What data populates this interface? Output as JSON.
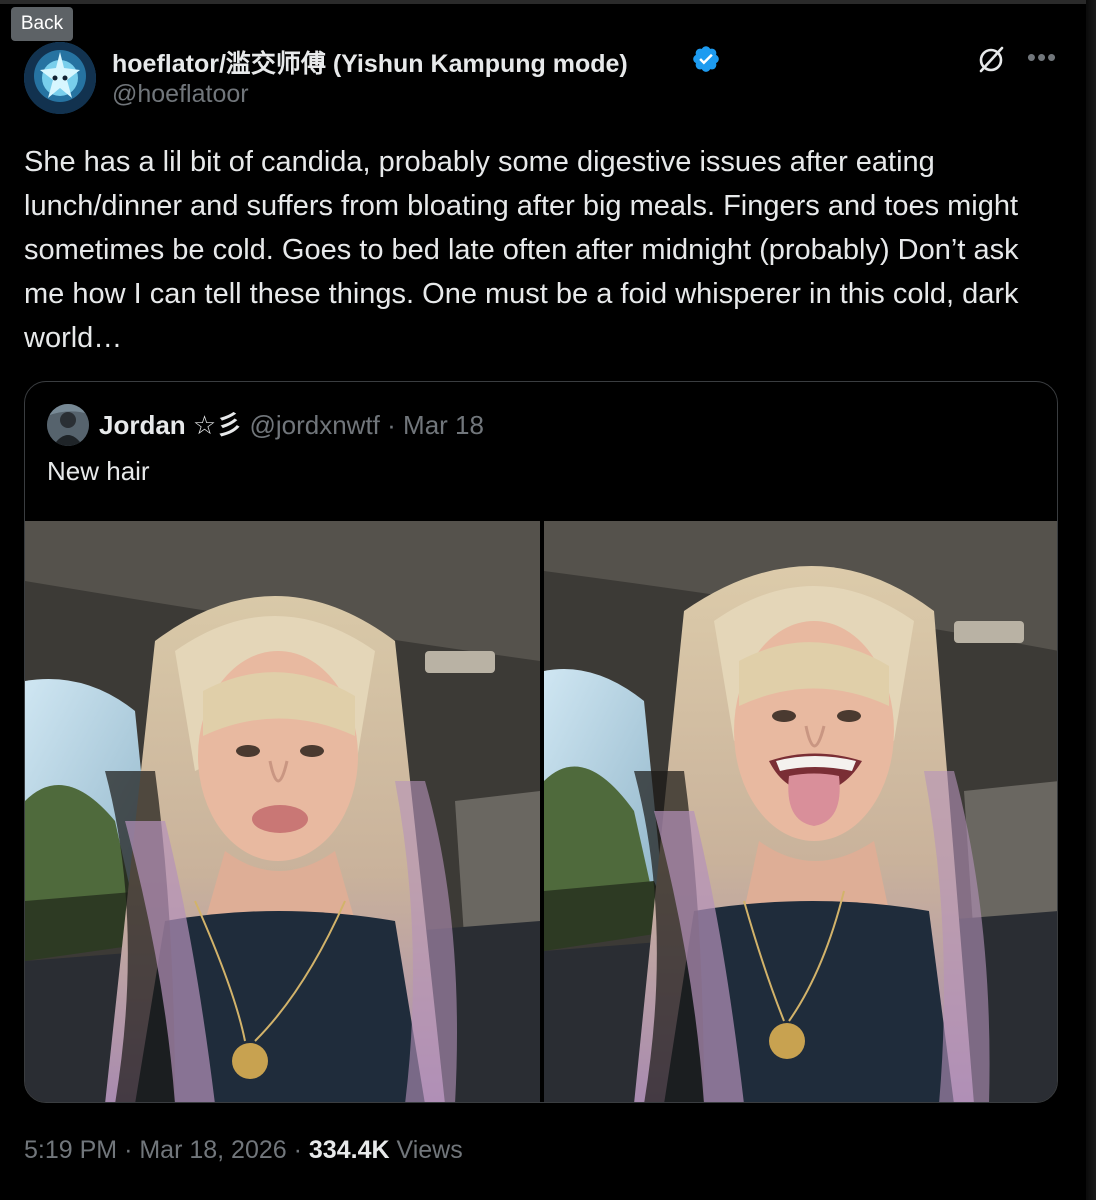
{
  "window": {
    "back_label": "Back"
  },
  "author": {
    "display_name": "hoeflator/滥交师傅 (Yishun Kampung mode)",
    "handle": "@hoeflatoor",
    "verified": true,
    "verified_color": "#1d9bf0"
  },
  "tweet": {
    "text": "She has a lil bit of candida, probably some digestive issues after eating lunch/dinner and suffers from bloating after big meals. Fingers and toes might sometimes be cold. Goes to bed late often after midnight (probably) Don’t ask me how I can tell these things. One must be a foid whisperer in this cold, dark world…",
    "time": "5:19 PM",
    "date": "Mar 18, 2026",
    "separator": "·",
    "views_count": "334.4K",
    "views_label": "Views"
  },
  "quoted": {
    "display_name": "Jordan ☆彡",
    "handle": "@jordxnwtf",
    "separator": "·",
    "date": "Mar 18",
    "text": "New hair",
    "photos": [
      "photo-kiss-face",
      "photo-tongue-out"
    ]
  },
  "icons": {
    "grok": "grok-icon",
    "more": "more-icon",
    "verified": "verified-badge-icon"
  },
  "colors": {
    "background": "#000000",
    "text": "#e7e9ea",
    "secondary": "#71767b",
    "border": "#3a3d40"
  }
}
